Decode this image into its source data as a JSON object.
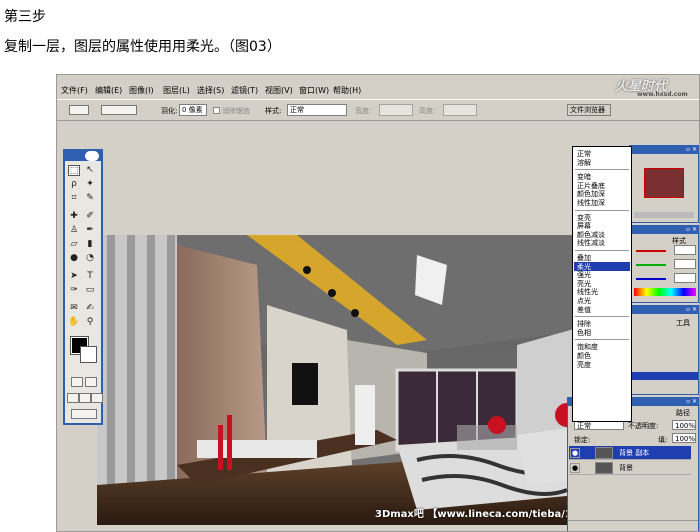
{
  "article": {
    "step_title": "第三步",
    "description": "复制一层，图层的属性使用用柔光。（图03）"
  },
  "menu": [
    "文件(F)",
    "编辑(E)",
    "图像(I)",
    "图层(L)",
    "选择(S)",
    "滤镜(T)",
    "视图(V)",
    "窗口(W)",
    "帮助(H)"
  ],
  "options": {
    "feather_label": "羽化:",
    "feather_value": "0 像素",
    "antialias_label": "消除锯齿",
    "style_label": "样式:",
    "style_value": "正常",
    "width_label": "宽度:",
    "height_label": "高度:",
    "file_browser": "文件浏览器"
  },
  "site_logo": "火星时代",
  "site_logo_sub": "www.hxsd.com",
  "blend_menu": {
    "items": [
      "正常",
      "溶解",
      "变暗",
      "正片叠底",
      "颜色加深",
      "线性加深",
      "变亮",
      "屏幕",
      "颜色减淡",
      "线性减淡",
      "叠加",
      "柔光",
      "强光",
      "亮光",
      "线性光",
      "点光",
      "差值",
      "排除",
      "色相",
      "饱和度",
      "颜色",
      "亮度"
    ],
    "selected": "柔光"
  },
  "palettes": {
    "color_tab": "样式",
    "tool_tab": "工具",
    "paths_tab": "路径",
    "blend_current": "正常",
    "opacity_label": "不透明度:",
    "opacity_value": "100%",
    "lock_label": "锁定:",
    "fill_label": "填:",
    "fill_value": "100%",
    "layer_copy": "背景 副本",
    "layer_bg": "背景"
  },
  "watermark": "3Dmax吧 【www.lineca.com/tieba/1771】",
  "colors": {
    "titlebar": "#2f5fb0",
    "selection": "#1f3fb0",
    "panel": "#d4d0c8"
  }
}
